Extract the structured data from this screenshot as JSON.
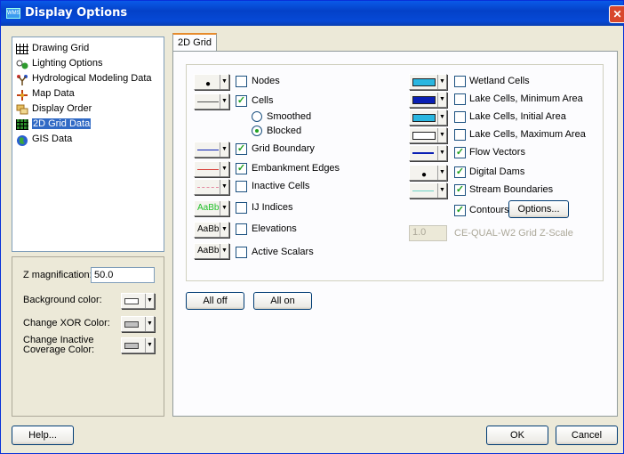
{
  "window": {
    "title": "Display Options",
    "app_icon_text": "WMS"
  },
  "tree": {
    "items": [
      {
        "label": "Drawing Grid",
        "icon": "grid-icon"
      },
      {
        "label": "Lighting Options",
        "icon": "lighting-icon"
      },
      {
        "label": "Hydrological Modeling Data",
        "icon": "hydro-icon"
      },
      {
        "label": "Map Data",
        "icon": "map-icon"
      },
      {
        "label": "Display Order",
        "icon": "display-order-icon"
      },
      {
        "label": "2D Grid Data",
        "icon": "grid2d-icon",
        "selected": true
      },
      {
        "label": "GIS Data",
        "icon": "globe-icon"
      }
    ]
  },
  "left_panel": {
    "z_label": "Z magnification:",
    "z_value": "50.0",
    "bg_label": "Background color:",
    "xor_label": "Change XOR Color:",
    "inactive_label": "Change Inactive Coverage Color:"
  },
  "tab": {
    "label": "2D Grid"
  },
  "left_options": {
    "nodes": "Nodes",
    "cells": "Cells",
    "smoothed": "Smoothed",
    "blocked": "Blocked",
    "grid_boundary": "Grid Boundary",
    "embankment_edges": "Embankment Edges",
    "inactive_cells": "Inactive Cells",
    "ij_indices": "IJ Indices",
    "elevations": "Elevations",
    "active_scalars": "Active Scalars",
    "aabb": "AaBb"
  },
  "right_options": {
    "wetland_cells": "Wetland Cells",
    "lake_min": "Lake Cells, Minimum Area",
    "lake_initial": "Lake Cells, Initial Area",
    "lake_max": "Lake Cells, Maximum Area",
    "flow_vectors": "Flow Vectors",
    "digital_dams": "Digital Dams",
    "stream_boundaries": "Stream Boundaries",
    "contours": "Contours",
    "options_button": "Options...",
    "zscale_value": "1.0",
    "zscale_label": "CE-QUAL-W2 Grid Z-Scale"
  },
  "buttons": {
    "all_off": "All off",
    "all_on": "All on",
    "help": "Help...",
    "ok": "OK",
    "cancel": "Cancel"
  },
  "colors": {
    "cyan": "#29b6e0",
    "blue": "#0a1fb4",
    "red": "#d8413a",
    "pink": "#e38aa0",
    "teal": "#6ed3c6",
    "aabb_green": "#22c02a"
  }
}
